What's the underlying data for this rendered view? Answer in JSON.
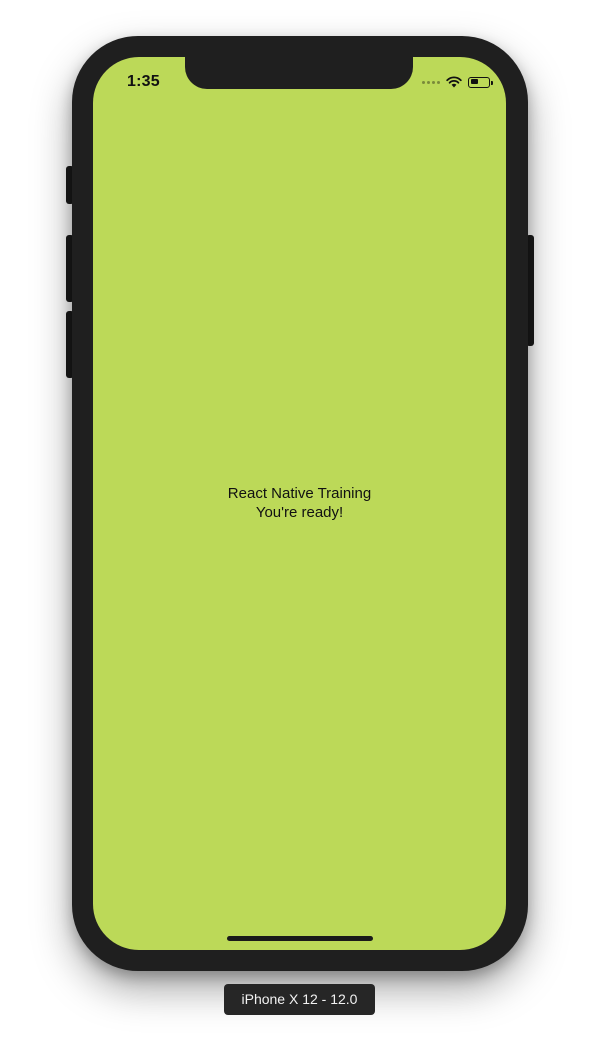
{
  "status_bar": {
    "time": "1:35",
    "battery_level": 0.3,
    "icons": [
      "cellular-signal-icon",
      "wifi-icon",
      "battery-icon"
    ]
  },
  "app": {
    "background_color": "#bcd958",
    "title": "React Native Training",
    "subtitle": "You're ready!"
  },
  "simulator": {
    "device_label": "iPhone X 12 - 12.0"
  }
}
